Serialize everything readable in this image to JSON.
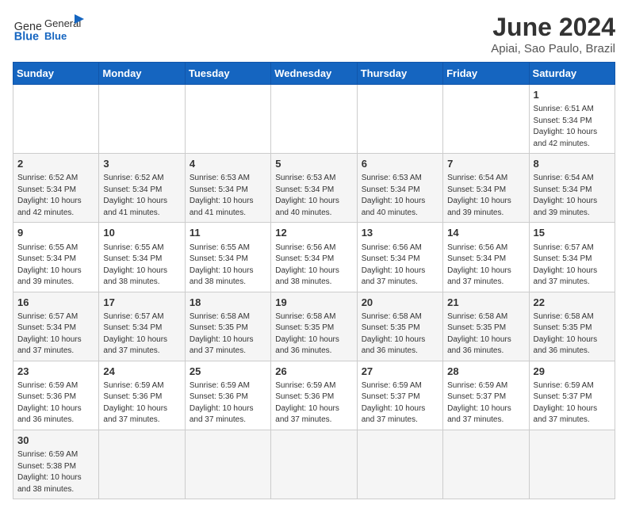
{
  "header": {
    "logo_text_general": "General",
    "logo_text_blue": "Blue",
    "title": "June 2024",
    "subtitle": "Apiai, Sao Paulo, Brazil"
  },
  "weekdays": [
    "Sunday",
    "Monday",
    "Tuesday",
    "Wednesday",
    "Thursday",
    "Friday",
    "Saturday"
  ],
  "weeks": [
    [
      {
        "day": "",
        "info": ""
      },
      {
        "day": "",
        "info": ""
      },
      {
        "day": "",
        "info": ""
      },
      {
        "day": "",
        "info": ""
      },
      {
        "day": "",
        "info": ""
      },
      {
        "day": "",
        "info": ""
      },
      {
        "day": "1",
        "info": "Sunrise: 6:51 AM\nSunset: 5:34 PM\nDaylight: 10 hours and 42 minutes."
      }
    ],
    [
      {
        "day": "2",
        "info": "Sunrise: 6:52 AM\nSunset: 5:34 PM\nDaylight: 10 hours and 42 minutes."
      },
      {
        "day": "3",
        "info": "Sunrise: 6:52 AM\nSunset: 5:34 PM\nDaylight: 10 hours and 41 minutes."
      },
      {
        "day": "4",
        "info": "Sunrise: 6:53 AM\nSunset: 5:34 PM\nDaylight: 10 hours and 41 minutes."
      },
      {
        "day": "5",
        "info": "Sunrise: 6:53 AM\nSunset: 5:34 PM\nDaylight: 10 hours and 40 minutes."
      },
      {
        "day": "6",
        "info": "Sunrise: 6:53 AM\nSunset: 5:34 PM\nDaylight: 10 hours and 40 minutes."
      },
      {
        "day": "7",
        "info": "Sunrise: 6:54 AM\nSunset: 5:34 PM\nDaylight: 10 hours and 39 minutes."
      },
      {
        "day": "8",
        "info": "Sunrise: 6:54 AM\nSunset: 5:34 PM\nDaylight: 10 hours and 39 minutes."
      }
    ],
    [
      {
        "day": "9",
        "info": "Sunrise: 6:55 AM\nSunset: 5:34 PM\nDaylight: 10 hours and 39 minutes."
      },
      {
        "day": "10",
        "info": "Sunrise: 6:55 AM\nSunset: 5:34 PM\nDaylight: 10 hours and 38 minutes."
      },
      {
        "day": "11",
        "info": "Sunrise: 6:55 AM\nSunset: 5:34 PM\nDaylight: 10 hours and 38 minutes."
      },
      {
        "day": "12",
        "info": "Sunrise: 6:56 AM\nSunset: 5:34 PM\nDaylight: 10 hours and 38 minutes."
      },
      {
        "day": "13",
        "info": "Sunrise: 6:56 AM\nSunset: 5:34 PM\nDaylight: 10 hours and 37 minutes."
      },
      {
        "day": "14",
        "info": "Sunrise: 6:56 AM\nSunset: 5:34 PM\nDaylight: 10 hours and 37 minutes."
      },
      {
        "day": "15",
        "info": "Sunrise: 6:57 AM\nSunset: 5:34 PM\nDaylight: 10 hours and 37 minutes."
      }
    ],
    [
      {
        "day": "16",
        "info": "Sunrise: 6:57 AM\nSunset: 5:34 PM\nDaylight: 10 hours and 37 minutes."
      },
      {
        "day": "17",
        "info": "Sunrise: 6:57 AM\nSunset: 5:34 PM\nDaylight: 10 hours and 37 minutes."
      },
      {
        "day": "18",
        "info": "Sunrise: 6:58 AM\nSunset: 5:35 PM\nDaylight: 10 hours and 37 minutes."
      },
      {
        "day": "19",
        "info": "Sunrise: 6:58 AM\nSunset: 5:35 PM\nDaylight: 10 hours and 36 minutes."
      },
      {
        "day": "20",
        "info": "Sunrise: 6:58 AM\nSunset: 5:35 PM\nDaylight: 10 hours and 36 minutes."
      },
      {
        "day": "21",
        "info": "Sunrise: 6:58 AM\nSunset: 5:35 PM\nDaylight: 10 hours and 36 minutes."
      },
      {
        "day": "22",
        "info": "Sunrise: 6:58 AM\nSunset: 5:35 PM\nDaylight: 10 hours and 36 minutes."
      }
    ],
    [
      {
        "day": "23",
        "info": "Sunrise: 6:59 AM\nSunset: 5:36 PM\nDaylight: 10 hours and 36 minutes."
      },
      {
        "day": "24",
        "info": "Sunrise: 6:59 AM\nSunset: 5:36 PM\nDaylight: 10 hours and 37 minutes."
      },
      {
        "day": "25",
        "info": "Sunrise: 6:59 AM\nSunset: 5:36 PM\nDaylight: 10 hours and 37 minutes."
      },
      {
        "day": "26",
        "info": "Sunrise: 6:59 AM\nSunset: 5:36 PM\nDaylight: 10 hours and 37 minutes."
      },
      {
        "day": "27",
        "info": "Sunrise: 6:59 AM\nSunset: 5:37 PM\nDaylight: 10 hours and 37 minutes."
      },
      {
        "day": "28",
        "info": "Sunrise: 6:59 AM\nSunset: 5:37 PM\nDaylight: 10 hours and 37 minutes."
      },
      {
        "day": "29",
        "info": "Sunrise: 6:59 AM\nSunset: 5:37 PM\nDaylight: 10 hours and 37 minutes."
      }
    ],
    [
      {
        "day": "30",
        "info": "Sunrise: 6:59 AM\nSunset: 5:38 PM\nDaylight: 10 hours and 38 minutes."
      },
      {
        "day": "",
        "info": ""
      },
      {
        "day": "",
        "info": ""
      },
      {
        "day": "",
        "info": ""
      },
      {
        "day": "",
        "info": ""
      },
      {
        "day": "",
        "info": ""
      },
      {
        "day": "",
        "info": ""
      }
    ]
  ]
}
